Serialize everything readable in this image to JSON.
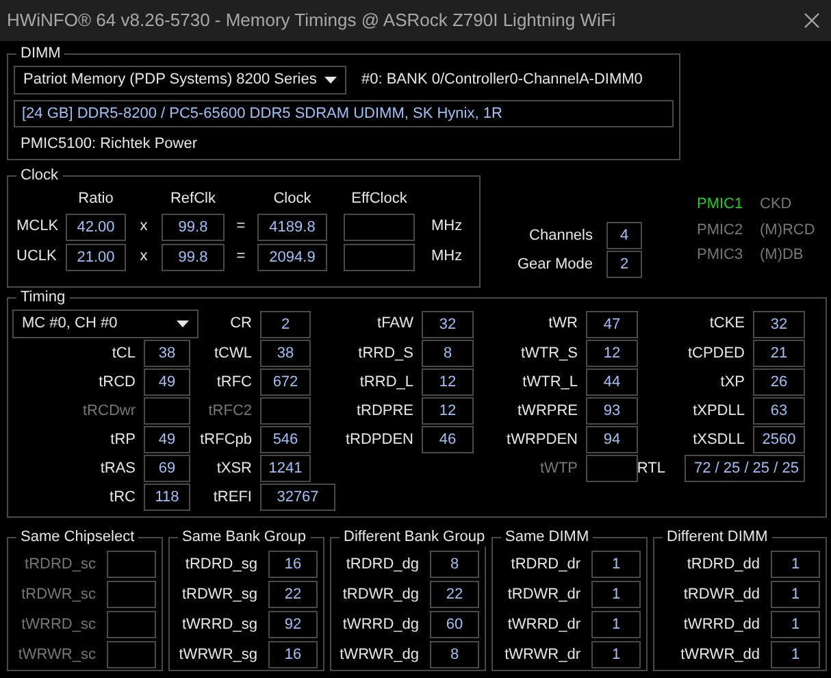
{
  "window": {
    "title": "HWiNFO® 64 v8.26-5730 - Memory Timings @ ASRock Z790I Lightning WiFi"
  },
  "dimm": {
    "title": "DIMM",
    "module": "Patriot Memory (PDP Systems) 8200 Series",
    "slot": "#0: BANK 0/Controller0-ChannelA-DIMM0",
    "info": "[24 GB] DDR5-8200 / PC5-65600 DDR5 SDRAM UDIMM, SK Hynix, 1R",
    "pmic": "PMIC5100: Richtek Power"
  },
  "clock": {
    "title": "Clock",
    "columns": [
      "Ratio",
      "RefClk",
      "Clock",
      "EffClock"
    ],
    "rows": [
      {
        "name": "MCLK",
        "ratio": "42.00",
        "times": "x",
        "refclk": "99.8",
        "equals": "=",
        "clock": "4189.8",
        "unit": "MHz"
      },
      {
        "name": "UCLK",
        "ratio": "21.00",
        "times": "x",
        "refclk": "99.8",
        "equals": "=",
        "clock": "2094.9",
        "unit": "MHz"
      }
    ]
  },
  "channels": {
    "label": "Channels",
    "value": "4"
  },
  "gear_mode": {
    "label": "Gear Mode",
    "value": "2"
  },
  "pmics": [
    {
      "name": "PMIC1",
      "type": "CKD",
      "active": true
    },
    {
      "name": "PMIC2",
      "type": "(M)RCD",
      "active": false
    },
    {
      "name": "PMIC3",
      "type": "(M)DB",
      "active": false
    }
  ],
  "timing": {
    "title": "Timing",
    "rows": [
      [
        {
          "kind": "dropdown",
          "value": "MC #0, CH #0"
        },
        {
          "kind": "field",
          "label": "CR",
          "value": "2",
          "disabled": false
        },
        {
          "kind": "field",
          "label": "tFAW",
          "value": "32",
          "disabled": false
        },
        {
          "kind": "field",
          "label": "tWR",
          "value": "47",
          "disabled": false
        },
        {
          "kind": "field",
          "label": "tCKE",
          "value": "32",
          "disabled": false
        }
      ],
      [
        {
          "kind": "field",
          "label": "tCL",
          "value": "38",
          "disabled": false
        },
        {
          "kind": "field",
          "label": "tCWL",
          "value": "38",
          "disabled": false
        },
        {
          "kind": "field",
          "label": "tRRD_S",
          "value": "8",
          "disabled": false
        },
        {
          "kind": "field",
          "label": "tWTR_S",
          "value": "12",
          "disabled": false
        },
        {
          "kind": "field",
          "label": "tCPDED",
          "value": "21",
          "disabled": false
        }
      ],
      [
        {
          "kind": "field",
          "label": "tRCD",
          "value": "49",
          "disabled": false
        },
        {
          "kind": "field",
          "label": "tRFC",
          "value": "672",
          "disabled": false
        },
        {
          "kind": "field",
          "label": "tRRD_L",
          "value": "12",
          "disabled": false
        },
        {
          "kind": "field",
          "label": "tWTR_L",
          "value": "44",
          "disabled": false
        },
        {
          "kind": "field",
          "label": "tXP",
          "value": "26",
          "disabled": false
        }
      ],
      [
        {
          "kind": "field",
          "label": "tRCDwr",
          "disabled": true
        },
        {
          "kind": "field",
          "label": "tRFC2",
          "disabled": true
        },
        {
          "kind": "field",
          "label": "tRDPRE",
          "value": "12",
          "disabled": false
        },
        {
          "kind": "field",
          "label": "tWRPRE",
          "value": "93",
          "disabled": false
        },
        {
          "kind": "field",
          "label": "tXPDLL",
          "value": "63",
          "disabled": false
        }
      ],
      [
        {
          "kind": "field",
          "label": "tRP",
          "value": "49",
          "disabled": false
        },
        {
          "kind": "field",
          "label": "tRFCpb",
          "value": "546",
          "disabled": false
        },
        {
          "kind": "field",
          "label": "tRDPDEN",
          "value": "46",
          "disabled": false
        },
        {
          "kind": "field",
          "label": "tWRPDEN",
          "value": "94",
          "disabled": false
        },
        {
          "kind": "field",
          "label": "tXSDLL",
          "value": "2560",
          "disabled": false
        }
      ],
      [
        {
          "kind": "field",
          "label": "tRAS",
          "value": "69",
          "disabled": false
        },
        {
          "kind": "field",
          "label": "tXSR",
          "value": "1241",
          "disabled": false
        },
        null,
        {
          "kind": "field",
          "label": "tWTP",
          "disabled": true
        },
        {
          "kind": "wide",
          "label": "RTL",
          "value": "72 / 25 / 25 / 25",
          "disabled": false
        }
      ],
      [
        {
          "kind": "field",
          "label": "tRC",
          "value": "118",
          "disabled": false
        },
        {
          "kind": "wide",
          "label": "tREFI",
          "value": "32767",
          "disabled": false
        },
        null,
        null,
        null
      ]
    ]
  },
  "groups": [
    {
      "title": "Same Chipselect",
      "items": [
        {
          "label": "tRDRD_sc",
          "disabled": true
        },
        {
          "label": "tRDWR_sc",
          "disabled": true
        },
        {
          "label": "tWRRD_sc",
          "disabled": true
        },
        {
          "label": "tWRWR_sc",
          "disabled": true
        }
      ]
    },
    {
      "title": "Same Bank Group",
      "items": [
        {
          "label": "tRDRD_sg",
          "value": "16",
          "disabled": false
        },
        {
          "label": "tRDWR_sg",
          "value": "22",
          "disabled": false
        },
        {
          "label": "tWRRD_sg",
          "value": "92",
          "disabled": false
        },
        {
          "label": "tWRWR_sg",
          "value": "16",
          "disabled": false
        }
      ]
    },
    {
      "title": "Different Bank Group",
      "items": [
        {
          "label": "tRDRD_dg",
          "value": "8",
          "disabled": false
        },
        {
          "label": "tRDWR_dg",
          "value": "22",
          "disabled": false
        },
        {
          "label": "tWRRD_dg",
          "value": "60",
          "disabled": false
        },
        {
          "label": "tWRWR_dg",
          "value": "8",
          "disabled": false
        }
      ]
    },
    {
      "title": "Same DIMM",
      "items": [
        {
          "label": "tRDRD_dr",
          "value": "1",
          "disabled": false
        },
        {
          "label": "tRDWR_dr",
          "value": "1",
          "disabled": false
        },
        {
          "label": "tWRRD_dr",
          "value": "1",
          "disabled": false
        },
        {
          "label": "tWRWR_dr",
          "value": "1",
          "disabled": false
        }
      ]
    },
    {
      "title": "Different DIMM",
      "items": [
        {
          "label": "tRDRD_dd",
          "value": "1",
          "disabled": false
        },
        {
          "label": "tRDWR_dd",
          "value": "1",
          "disabled": false
        },
        {
          "label": "tWRRD_dd",
          "value": "1",
          "disabled": false
        },
        {
          "label": "tWRWR_dd",
          "value": "1",
          "disabled": false
        }
      ]
    }
  ]
}
